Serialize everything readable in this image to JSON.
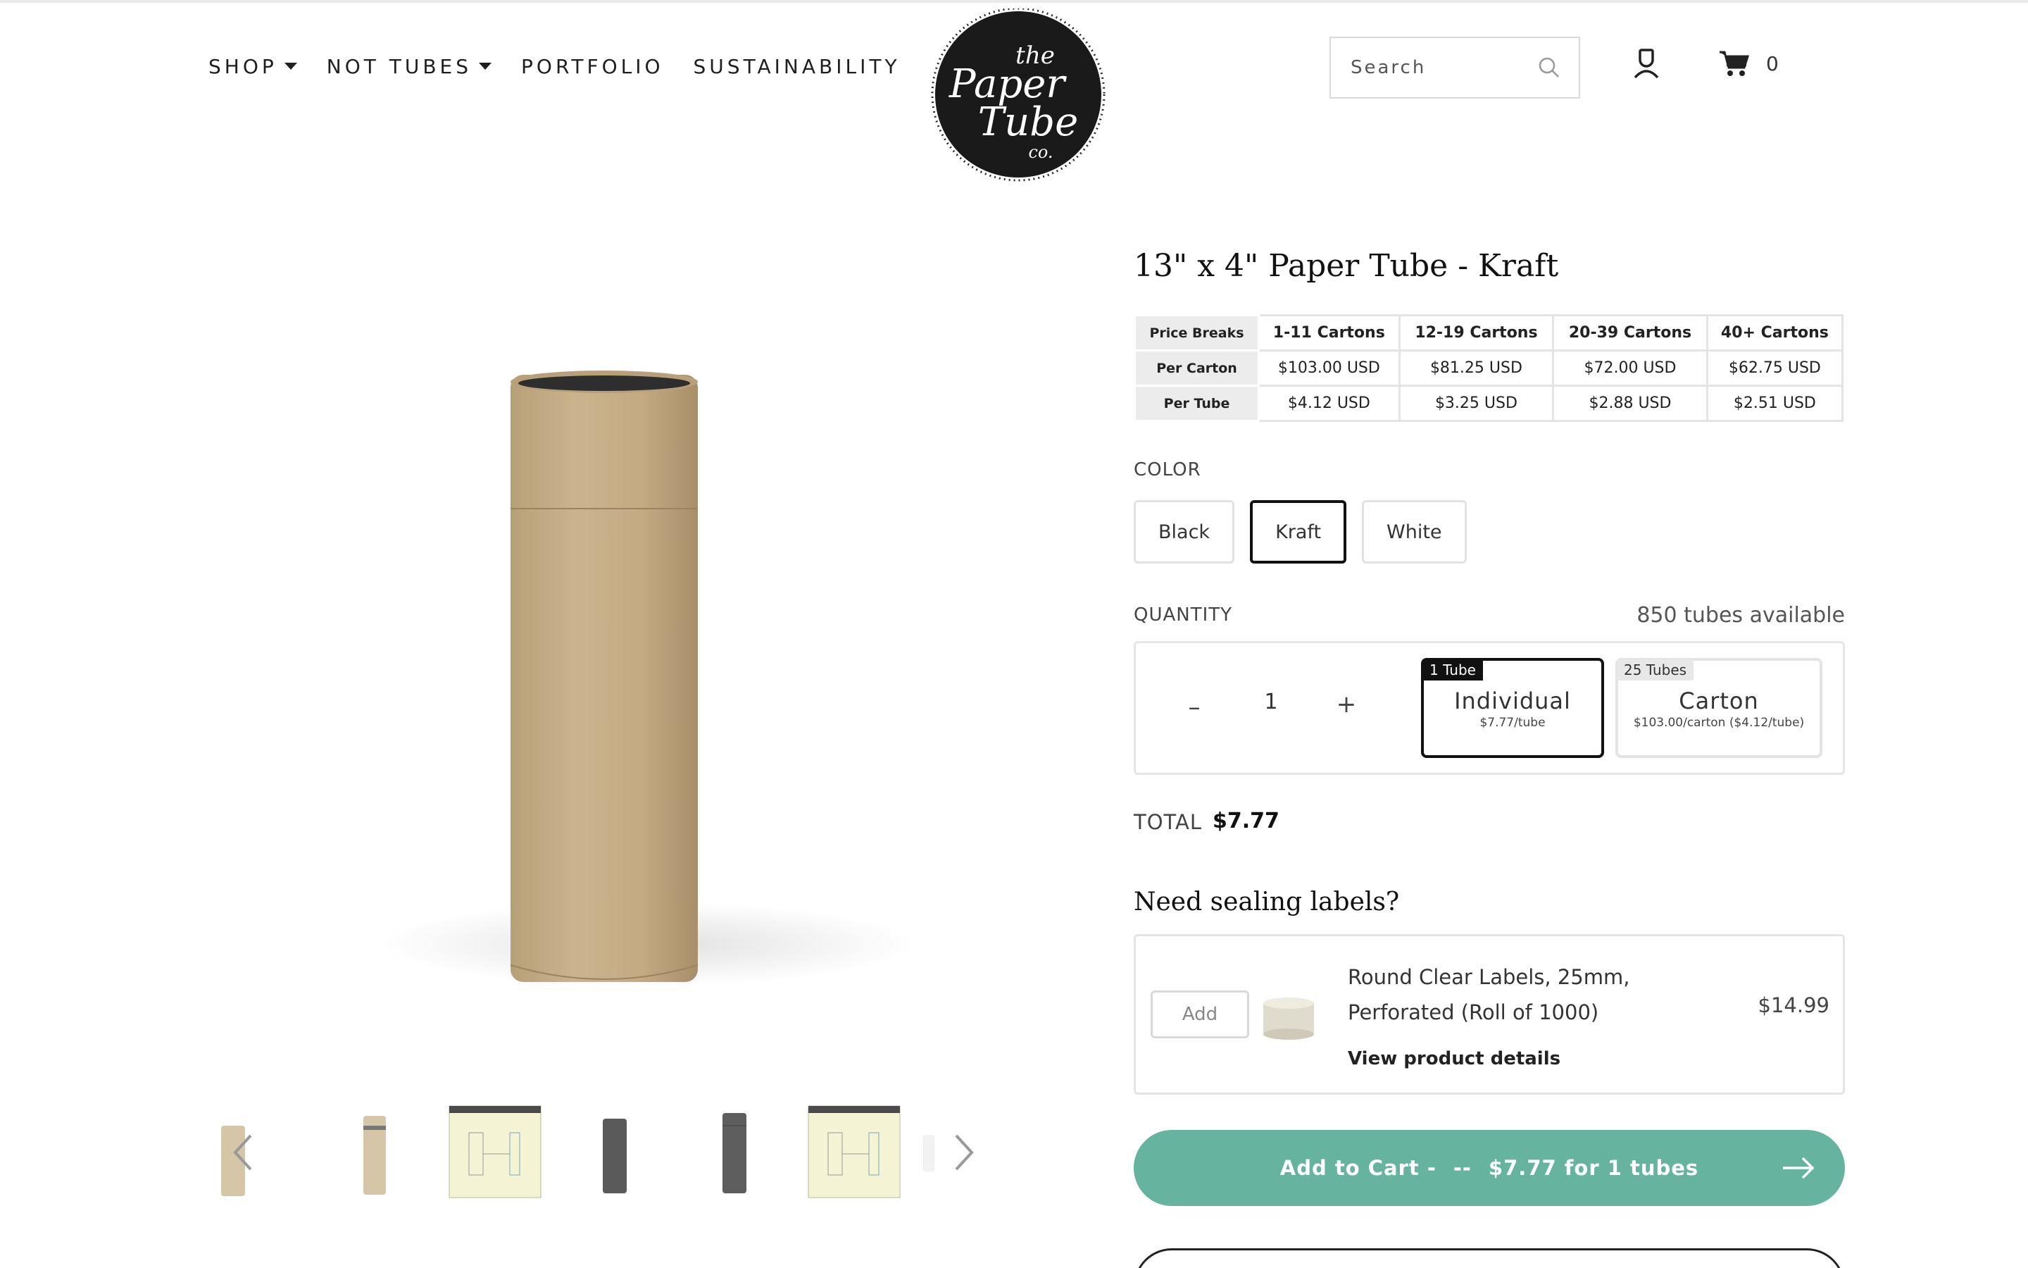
{
  "nav": {
    "items": [
      {
        "label": "SHOP"
      },
      {
        "label": "NOT TUBES"
      },
      {
        "label": "PORTFOLIO"
      },
      {
        "label": "SUSTAINABILITY"
      }
    ]
  },
  "logo": {
    "text_lines": [
      "the",
      "Paper",
      "Tube",
      "co."
    ]
  },
  "search": {
    "placeholder": "Search",
    "icon": "search-icon"
  },
  "cart": {
    "count": "0",
    "icon": "cart-icon"
  },
  "account": {
    "icon": "user-icon"
  },
  "product": {
    "title": "13\" x 4\" Paper Tube - Kraft",
    "price_table": {
      "header": [
        "Price Breaks",
        "1-11 Cartons",
        "12-19 Cartons",
        "20-39 Cartons",
        "40+ Cartons"
      ],
      "rows": [
        [
          "Per Carton",
          "$103.00 USD",
          "$81.25 USD",
          "$72.00 USD",
          "$62.75 USD"
        ],
        [
          "Per Tube",
          "$4.12 USD",
          "$3.25 USD",
          "$2.88 USD",
          "$2.51 USD"
        ]
      ]
    },
    "color": {
      "label": "COLOR",
      "options": [
        "Black",
        "Kraft",
        "White"
      ],
      "selected": "Kraft"
    },
    "quantity": {
      "label": "QUANTITY",
      "available": "850 tubes available",
      "minus": "–",
      "plus": "+",
      "value": "1",
      "packs": [
        {
          "tag": "1 Tube",
          "name": "Individual",
          "sub": "$7.77/tube"
        },
        {
          "tag": "25 Tubes",
          "name": "Carton",
          "sub": "$103.00/carton ($4.12/tube)"
        }
      ]
    },
    "total": {
      "label": "TOTAL",
      "value": "$7.77"
    },
    "labels_upsell": {
      "heading": "Need sealing labels?",
      "add": "Add",
      "name": "Round Clear Labels, 25mm, Perforated (Roll of 1000)",
      "price": "$14.99",
      "details": "View product details"
    },
    "add_to_cart": {
      "prefix": "Add to Cart -",
      "sep": "--",
      "text": "$7.77 for 1 tubes"
    }
  },
  "colors": {
    "accent": "#66b3a0",
    "kraft": "#c7b08c",
    "dark": "#111111"
  }
}
